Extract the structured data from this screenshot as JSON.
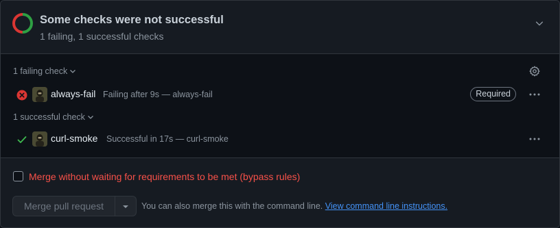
{
  "header": {
    "title": "Some checks were not successful",
    "subtitle": "1 failing, 1 successful checks",
    "ring_colors": {
      "fail": "#da3633",
      "success": "#2ea043"
    }
  },
  "failing_group": {
    "label": "1 failing check",
    "checks": [
      {
        "name": "always-fail",
        "description": "Failing after 9s — always-fail",
        "badge": "Required",
        "status": "fail",
        "status_color": "#da3633"
      }
    ]
  },
  "successful_group": {
    "label": "1 successful check",
    "checks": [
      {
        "name": "curl-smoke",
        "description": "Successful in 17s — curl-smoke",
        "status": "success",
        "status_color": "#3fb950"
      }
    ]
  },
  "footer": {
    "bypass_label": "Merge without waiting for requirements to be met (bypass rules)",
    "merge_button": "Merge pull request",
    "cli_text": "You can also merge this with the command line.",
    "cli_link": "View command line instructions."
  },
  "icons": [
    "status-ring-icon",
    "chevron-down-icon",
    "gear-icon",
    "x-circle-icon",
    "check-icon",
    "kebab-icon",
    "caret-down-icon"
  ]
}
